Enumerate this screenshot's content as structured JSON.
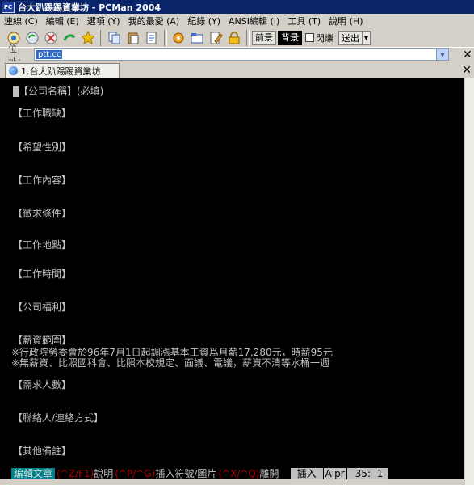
{
  "window": {
    "title": "台大趴踢踢資業坊 - PCMan 2004",
    "logo_text": "PC"
  },
  "menu": [
    "連線 (C)",
    "編輯 (E)",
    "選項 (Y)",
    "我的最愛 (A)",
    "紀錄 (Y)",
    "ANSI編輯 (I)",
    "工具 (T)",
    "說明 (H)"
  ],
  "toolbar": {
    "icons": [
      "connect-icon",
      "reconnect-icon",
      "disconnect-icon",
      "repeat-icon",
      "favorite-star-icon",
      "copy-icon",
      "paste-icon",
      "copy-ansi-icon",
      "settings-icon",
      "open-folder-icon",
      "edit-icon",
      "lock-icon"
    ],
    "fg_label": "前景",
    "bg_label": "背景",
    "blink_label": "閃爍",
    "send_label": "送出"
  },
  "address": {
    "label": "位址：",
    "value": "ptt.cc",
    "close_glyph": "✕"
  },
  "tabs": [
    {
      "label": "1.台大趴踢踢資業坊"
    }
  ],
  "tab_close_glyph": "✕",
  "terminal": {
    "lines": [
      "【公司名稱】(必填)",
      "【工作職缺】",
      "【希望性別】",
      "【工作內容】",
      "【徵求條件】",
      "【工作地點】",
      "【工作時間】",
      "【公司福利】",
      "【薪資範圍】",
      "※行政院勞委會於96年7月1日起調漲基本工資爲月薪17,280元，時薪95元",
      "※無薪資、比照國科會、比照本校規定、面議、電議，薪資不清等水桶一週",
      "【需求人數】",
      "【聯絡人/連絡方式】",
      "【其他備註】"
    ]
  },
  "status": {
    "mode": "編輯文章",
    "key1": "(^Z/F1)",
    "desc1": "說明",
    "key2": "(^P/^G)",
    "desc2": "插入符號/圖片",
    "key3": "(^X/^Q)",
    "desc3": "離開",
    "insert": "插入",
    "encoding": "Aipr",
    "position": "35:  1"
  },
  "colors": {
    "terminal_bg": "#000000",
    "terminal_fg": "#c0c0c0",
    "status_mode_bg": "#00808a",
    "status_key": "#b00000",
    "titlebar": "#0a246a"
  }
}
